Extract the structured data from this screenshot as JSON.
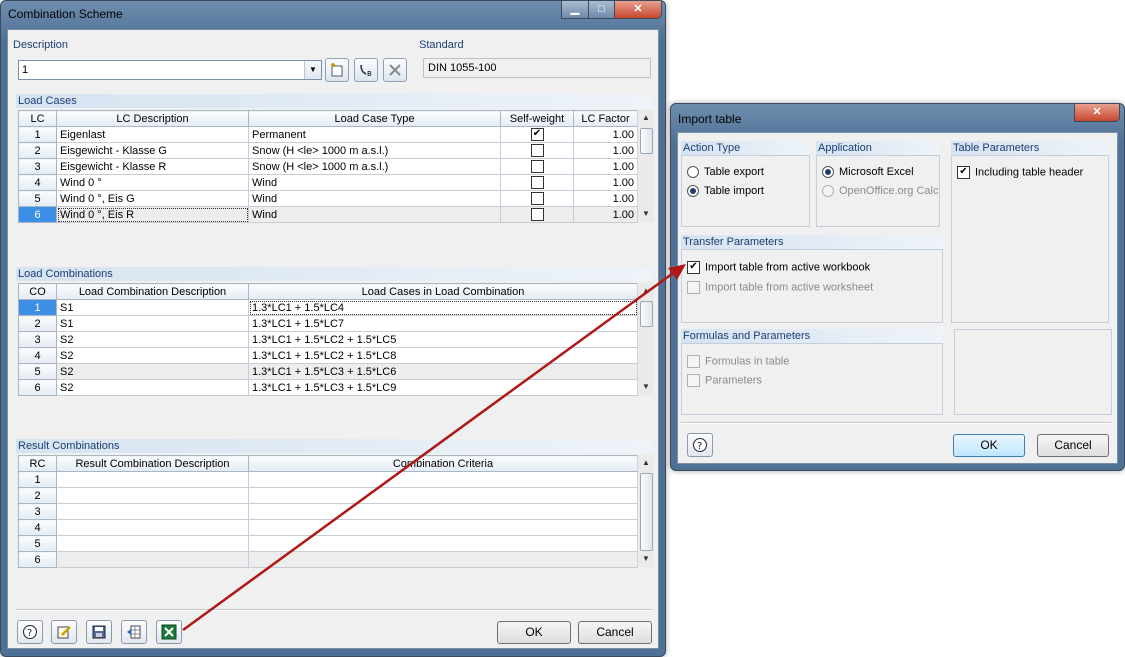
{
  "main_window": {
    "title": "Combination Scheme",
    "minimize": "▁",
    "maximize": "□",
    "close": "✕"
  },
  "description": {
    "label": "Description",
    "value": "1",
    "standard_label": "Standard",
    "standard_value": "DIN 1055-100"
  },
  "load_cases": {
    "title": "Load Cases",
    "headers": [
      "LC",
      "LC Description",
      "Load Case Type",
      "Self-weight",
      "LC Factor"
    ],
    "rows": [
      {
        "no": "1",
        "desc": "Eigenlast",
        "type": "Permanent",
        "selfweight": true,
        "factor": "1.00"
      },
      {
        "no": "2",
        "desc": "Eisgewicht - Klasse G",
        "type": "Snow (H <le> 1000 m a.s.l.)",
        "selfweight": false,
        "factor": "1.00"
      },
      {
        "no": "3",
        "desc": "Eisgewicht - Klasse R",
        "type": "Snow (H <le> 1000 m a.s.l.)",
        "selfweight": false,
        "factor": "1.00"
      },
      {
        "no": "4",
        "desc": "Wind 0 °",
        "type": "Wind",
        "selfweight": false,
        "factor": "1.00"
      },
      {
        "no": "5",
        "desc": "Wind 0 °, Eis G",
        "type": "Wind",
        "selfweight": false,
        "factor": "1.00"
      },
      {
        "no": "6",
        "desc": "Wind 0 °, Eis R",
        "type": "Wind",
        "selfweight": false,
        "factor": "1.00"
      }
    ]
  },
  "load_combinations": {
    "title": "Load Combinations",
    "headers": [
      "CO",
      "Load Combination Description",
      "Load Cases in Load Combination"
    ],
    "rows": [
      {
        "no": "1",
        "desc": "S1",
        "cases": "1.3*LC1 + 1.5*LC4"
      },
      {
        "no": "2",
        "desc": "S1",
        "cases": "1.3*LC1 + 1.5*LC7"
      },
      {
        "no": "3",
        "desc": "S2",
        "cases": "1.3*LC1 + 1.5*LC2 + 1.5*LC5"
      },
      {
        "no": "4",
        "desc": "S2",
        "cases": "1.3*LC1 + 1.5*LC2 + 1.5*LC8"
      },
      {
        "no": "5",
        "desc": "S2",
        "cases": "1.3*LC1 + 1.5*LC3 + 1.5*LC6"
      },
      {
        "no": "6",
        "desc": "S2",
        "cases": "1.3*LC1 + 1.5*LC3 + 1.5*LC9"
      }
    ]
  },
  "result_combinations": {
    "title": "Result Combinations",
    "headers": [
      "RC",
      "Result Combination Description",
      "Combination Criteria"
    ],
    "rows": [
      "1",
      "2",
      "3",
      "4",
      "5",
      "6"
    ]
  },
  "main_buttons": {
    "ok": "OK",
    "cancel": "Cancel"
  },
  "import_dialog": {
    "title": "Import table",
    "close": "✕",
    "action_type": {
      "title": "Action Type",
      "options": [
        "Table export",
        "Table import"
      ],
      "selected": "Table import"
    },
    "application": {
      "title": "Application",
      "options": [
        "Microsoft Excel",
        "OpenOffice.org Calc"
      ],
      "selected": "Microsoft Excel"
    },
    "table_parameters": {
      "title": "Table Parameters",
      "include_header_label": "Including table header",
      "include_header_checked": true
    },
    "transfer_parameters": {
      "title": "Transfer Parameters",
      "from_workbook_label": "Import table from active workbook",
      "from_workbook_checked": true,
      "from_worksheet_label": "Import table from active worksheet",
      "from_worksheet_checked": false
    },
    "formulas": {
      "title": "Formulas and Parameters",
      "formulas_label": "Formulas in table",
      "parameters_label": "Parameters"
    },
    "ok": "OK",
    "cancel": "Cancel"
  },
  "colors": {
    "selection": "#3d8ee6",
    "group_title": "#1b3e74",
    "arrow": "#b01818"
  }
}
